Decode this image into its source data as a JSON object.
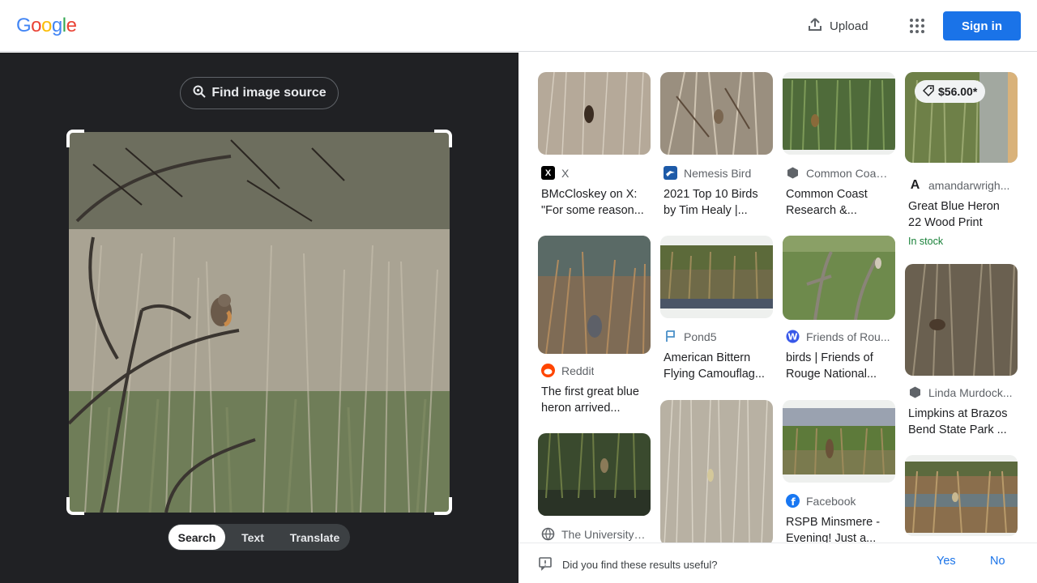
{
  "header": {
    "logo": "Google",
    "upload_label": "Upload",
    "signin_label": "Sign in"
  },
  "left": {
    "find_source_label": "Find image source",
    "tabs": [
      {
        "label": "Search",
        "active": true
      },
      {
        "label": "Text",
        "active": false
      },
      {
        "label": "Translate",
        "active": false
      }
    ]
  },
  "results": [
    {
      "source": "X",
      "title": "BMcCloskey on X: \"For some reason..."
    },
    {
      "source": "Nemesis Bird",
      "title": "2021 Top 10 Birds by Tim Healy |..."
    },
    {
      "source": "Common Coas...",
      "title": "Common Coast Research &..."
    },
    {
      "source": "amandarwrigh...",
      "title": "Great Blue Heron 22 Wood Print",
      "price": "$56.00*",
      "stock": "In stock"
    },
    {
      "source": "Reddit",
      "title": "The first great blue heron arrived..."
    },
    {
      "source": "Pond5",
      "title": "American Bittern Flying Camouflag..."
    },
    {
      "source": "Friends of Rou...",
      "title": "birds | Friends of Rouge National..."
    },
    {
      "source": "Linda Murdock...",
      "title": "Limpkins at Brazos Bend State Park ..."
    },
    {
      "source": "The University ...",
      "title": ""
    },
    {
      "source": "",
      "title": ""
    },
    {
      "source": "Facebook",
      "title": "RSPB Minsmere - Evening! Just a..."
    },
    {
      "source": "",
      "title": ""
    }
  ],
  "footer": {
    "question": "Did you find these results useful?",
    "yes": "Yes",
    "no": "No"
  },
  "colors": {
    "accent": "#1a73e8",
    "dark_panel": "#202124",
    "stock": "#188038"
  }
}
